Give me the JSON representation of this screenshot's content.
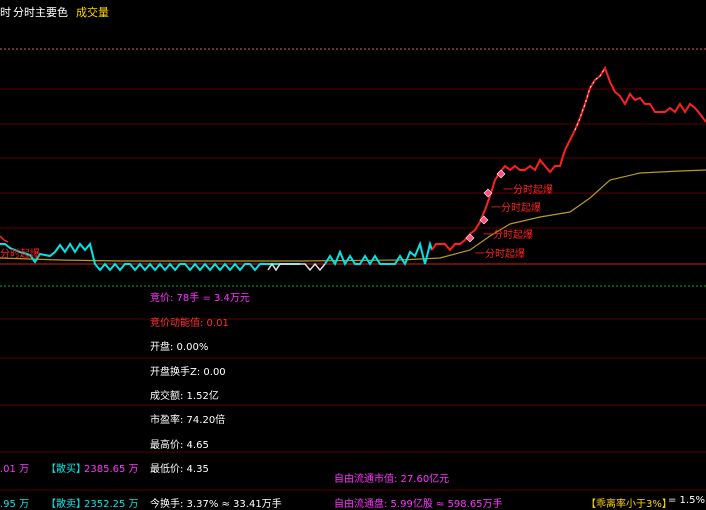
{
  "header": {
    "left_fragment": "时",
    "title": "分时主要色",
    "volume_label": "成交量"
  },
  "colors": {
    "background": "#000000",
    "price_up": "#ff2020",
    "price_down": "#00e5e5",
    "avg_line": "#b89a20",
    "grid": "#5a0000",
    "dashed_top": "#c86464",
    "dashed_bottom": "#00b000"
  },
  "annotations": {
    "surge_label": "分时起爆",
    "surge_labels": [
      "分时起爆",
      "一分时起爆",
      "一分时起爆",
      "一分时起爆",
      "一分时起爆"
    ]
  },
  "info_panel": {
    "bid_price": "竞价: 78手 = 3.4万元",
    "bid_momentum": "竞价动能值: 0.01",
    "open_pct": "开盘: 0.00%",
    "open_turnover": "开盘换手Z: 0.00",
    "turnover_amount": "成交额: 1.52亿",
    "pe_ratio": "市盈率: 74.20倍",
    "high_price": "最高价: 4.65",
    "low_price": "最低价: 4.35",
    "today_turnover": "今换手: 3.37% ≈ 33.41万手"
  },
  "float_panel": {
    "float_mcap": "自由流通市值: 27.60亿元",
    "float_shares": "自由流通盘: 5.99亿股 ≈ 598.65万手"
  },
  "left_panel": {
    "row1_value": ".01 万",
    "row1_tag": "【散买】",
    "row1_amount": "2385.65 万",
    "row2_value": ".95 万",
    "row2_tag": "【散卖】",
    "row2_amount": "2352.25 万"
  },
  "deviation": {
    "label": "【乖离率小于3%】",
    "value": "= 1.5%"
  }
}
